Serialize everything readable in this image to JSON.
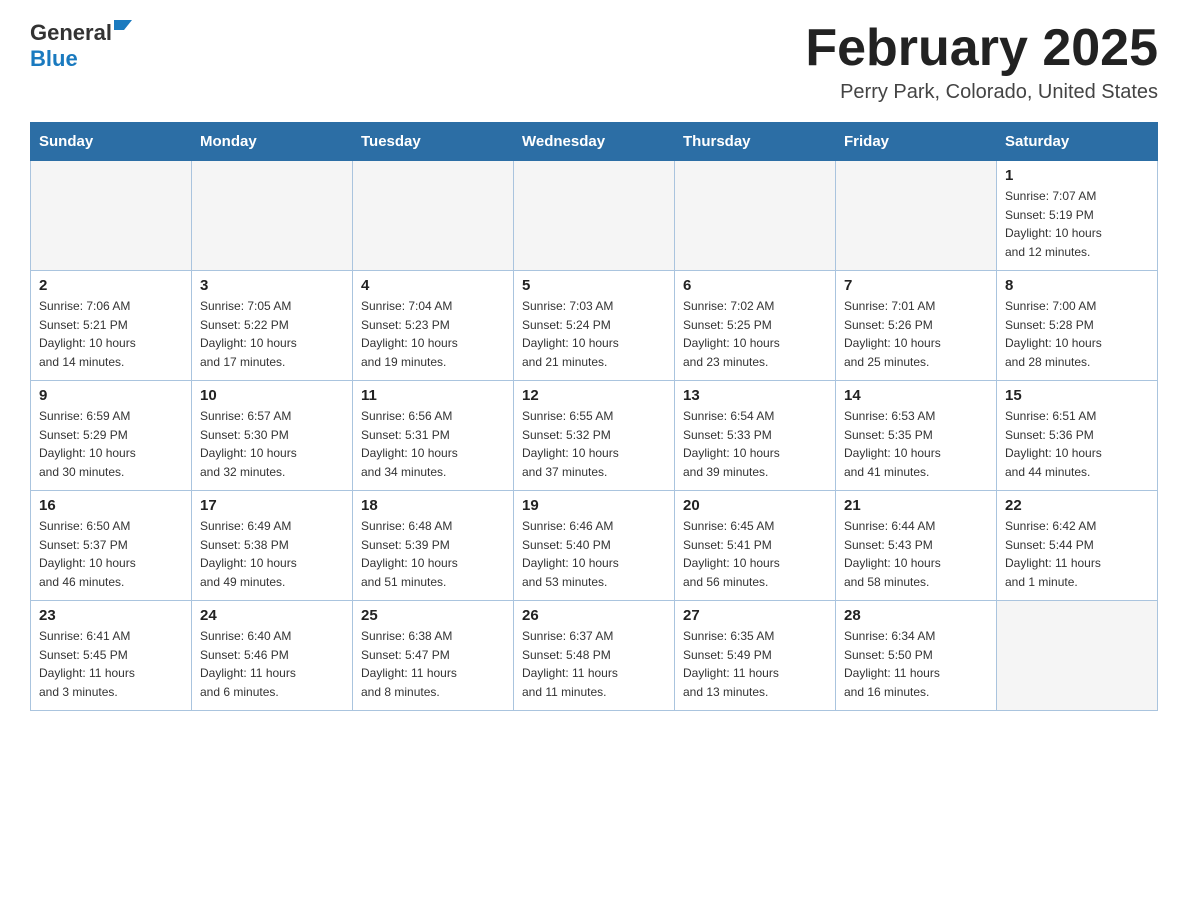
{
  "header": {
    "logo_general": "General",
    "logo_blue": "Blue",
    "month_title": "February 2025",
    "location": "Perry Park, Colorado, United States"
  },
  "weekdays": [
    "Sunday",
    "Monday",
    "Tuesday",
    "Wednesday",
    "Thursday",
    "Friday",
    "Saturday"
  ],
  "weeks": [
    [
      {
        "day": "",
        "info": ""
      },
      {
        "day": "",
        "info": ""
      },
      {
        "day": "",
        "info": ""
      },
      {
        "day": "",
        "info": ""
      },
      {
        "day": "",
        "info": ""
      },
      {
        "day": "",
        "info": ""
      },
      {
        "day": "1",
        "info": "Sunrise: 7:07 AM\nSunset: 5:19 PM\nDaylight: 10 hours\nand 12 minutes."
      }
    ],
    [
      {
        "day": "2",
        "info": "Sunrise: 7:06 AM\nSunset: 5:21 PM\nDaylight: 10 hours\nand 14 minutes."
      },
      {
        "day": "3",
        "info": "Sunrise: 7:05 AM\nSunset: 5:22 PM\nDaylight: 10 hours\nand 17 minutes."
      },
      {
        "day": "4",
        "info": "Sunrise: 7:04 AM\nSunset: 5:23 PM\nDaylight: 10 hours\nand 19 minutes."
      },
      {
        "day": "5",
        "info": "Sunrise: 7:03 AM\nSunset: 5:24 PM\nDaylight: 10 hours\nand 21 minutes."
      },
      {
        "day": "6",
        "info": "Sunrise: 7:02 AM\nSunset: 5:25 PM\nDaylight: 10 hours\nand 23 minutes."
      },
      {
        "day": "7",
        "info": "Sunrise: 7:01 AM\nSunset: 5:26 PM\nDaylight: 10 hours\nand 25 minutes."
      },
      {
        "day": "8",
        "info": "Sunrise: 7:00 AM\nSunset: 5:28 PM\nDaylight: 10 hours\nand 28 minutes."
      }
    ],
    [
      {
        "day": "9",
        "info": "Sunrise: 6:59 AM\nSunset: 5:29 PM\nDaylight: 10 hours\nand 30 minutes."
      },
      {
        "day": "10",
        "info": "Sunrise: 6:57 AM\nSunset: 5:30 PM\nDaylight: 10 hours\nand 32 minutes."
      },
      {
        "day": "11",
        "info": "Sunrise: 6:56 AM\nSunset: 5:31 PM\nDaylight: 10 hours\nand 34 minutes."
      },
      {
        "day": "12",
        "info": "Sunrise: 6:55 AM\nSunset: 5:32 PM\nDaylight: 10 hours\nand 37 minutes."
      },
      {
        "day": "13",
        "info": "Sunrise: 6:54 AM\nSunset: 5:33 PM\nDaylight: 10 hours\nand 39 minutes."
      },
      {
        "day": "14",
        "info": "Sunrise: 6:53 AM\nSunset: 5:35 PM\nDaylight: 10 hours\nand 41 minutes."
      },
      {
        "day": "15",
        "info": "Sunrise: 6:51 AM\nSunset: 5:36 PM\nDaylight: 10 hours\nand 44 minutes."
      }
    ],
    [
      {
        "day": "16",
        "info": "Sunrise: 6:50 AM\nSunset: 5:37 PM\nDaylight: 10 hours\nand 46 minutes."
      },
      {
        "day": "17",
        "info": "Sunrise: 6:49 AM\nSunset: 5:38 PM\nDaylight: 10 hours\nand 49 minutes."
      },
      {
        "day": "18",
        "info": "Sunrise: 6:48 AM\nSunset: 5:39 PM\nDaylight: 10 hours\nand 51 minutes."
      },
      {
        "day": "19",
        "info": "Sunrise: 6:46 AM\nSunset: 5:40 PM\nDaylight: 10 hours\nand 53 minutes."
      },
      {
        "day": "20",
        "info": "Sunrise: 6:45 AM\nSunset: 5:41 PM\nDaylight: 10 hours\nand 56 minutes."
      },
      {
        "day": "21",
        "info": "Sunrise: 6:44 AM\nSunset: 5:43 PM\nDaylight: 10 hours\nand 58 minutes."
      },
      {
        "day": "22",
        "info": "Sunrise: 6:42 AM\nSunset: 5:44 PM\nDaylight: 11 hours\nand 1 minute."
      }
    ],
    [
      {
        "day": "23",
        "info": "Sunrise: 6:41 AM\nSunset: 5:45 PM\nDaylight: 11 hours\nand 3 minutes."
      },
      {
        "day": "24",
        "info": "Sunrise: 6:40 AM\nSunset: 5:46 PM\nDaylight: 11 hours\nand 6 minutes."
      },
      {
        "day": "25",
        "info": "Sunrise: 6:38 AM\nSunset: 5:47 PM\nDaylight: 11 hours\nand 8 minutes."
      },
      {
        "day": "26",
        "info": "Sunrise: 6:37 AM\nSunset: 5:48 PM\nDaylight: 11 hours\nand 11 minutes."
      },
      {
        "day": "27",
        "info": "Sunrise: 6:35 AM\nSunset: 5:49 PM\nDaylight: 11 hours\nand 13 minutes."
      },
      {
        "day": "28",
        "info": "Sunrise: 6:34 AM\nSunset: 5:50 PM\nDaylight: 11 hours\nand 16 minutes."
      },
      {
        "day": "",
        "info": ""
      }
    ]
  ]
}
